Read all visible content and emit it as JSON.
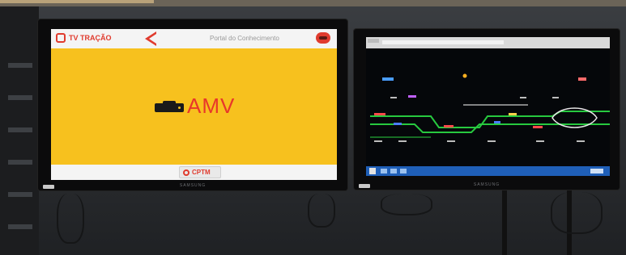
{
  "left_display": {
    "header": {
      "app_name": "TV TRAÇÃO",
      "page_title": "Portal do Conhecimento"
    },
    "main": {
      "label": "AMV"
    },
    "footer": {
      "logo_text": "CPTM"
    },
    "colors": {
      "background": "#f7c11e",
      "accent": "#e03b2e",
      "header": "#f4f4f4"
    }
  },
  "right_display": {
    "description_icons": [
      "browser-window",
      "track-schematic",
      "windows-taskbar"
    ],
    "colors": {
      "background": "#05070a",
      "track": "#27c93f",
      "taskbar": "#1f5fb8"
    }
  },
  "monitor_brand": "SAMSUNG"
}
